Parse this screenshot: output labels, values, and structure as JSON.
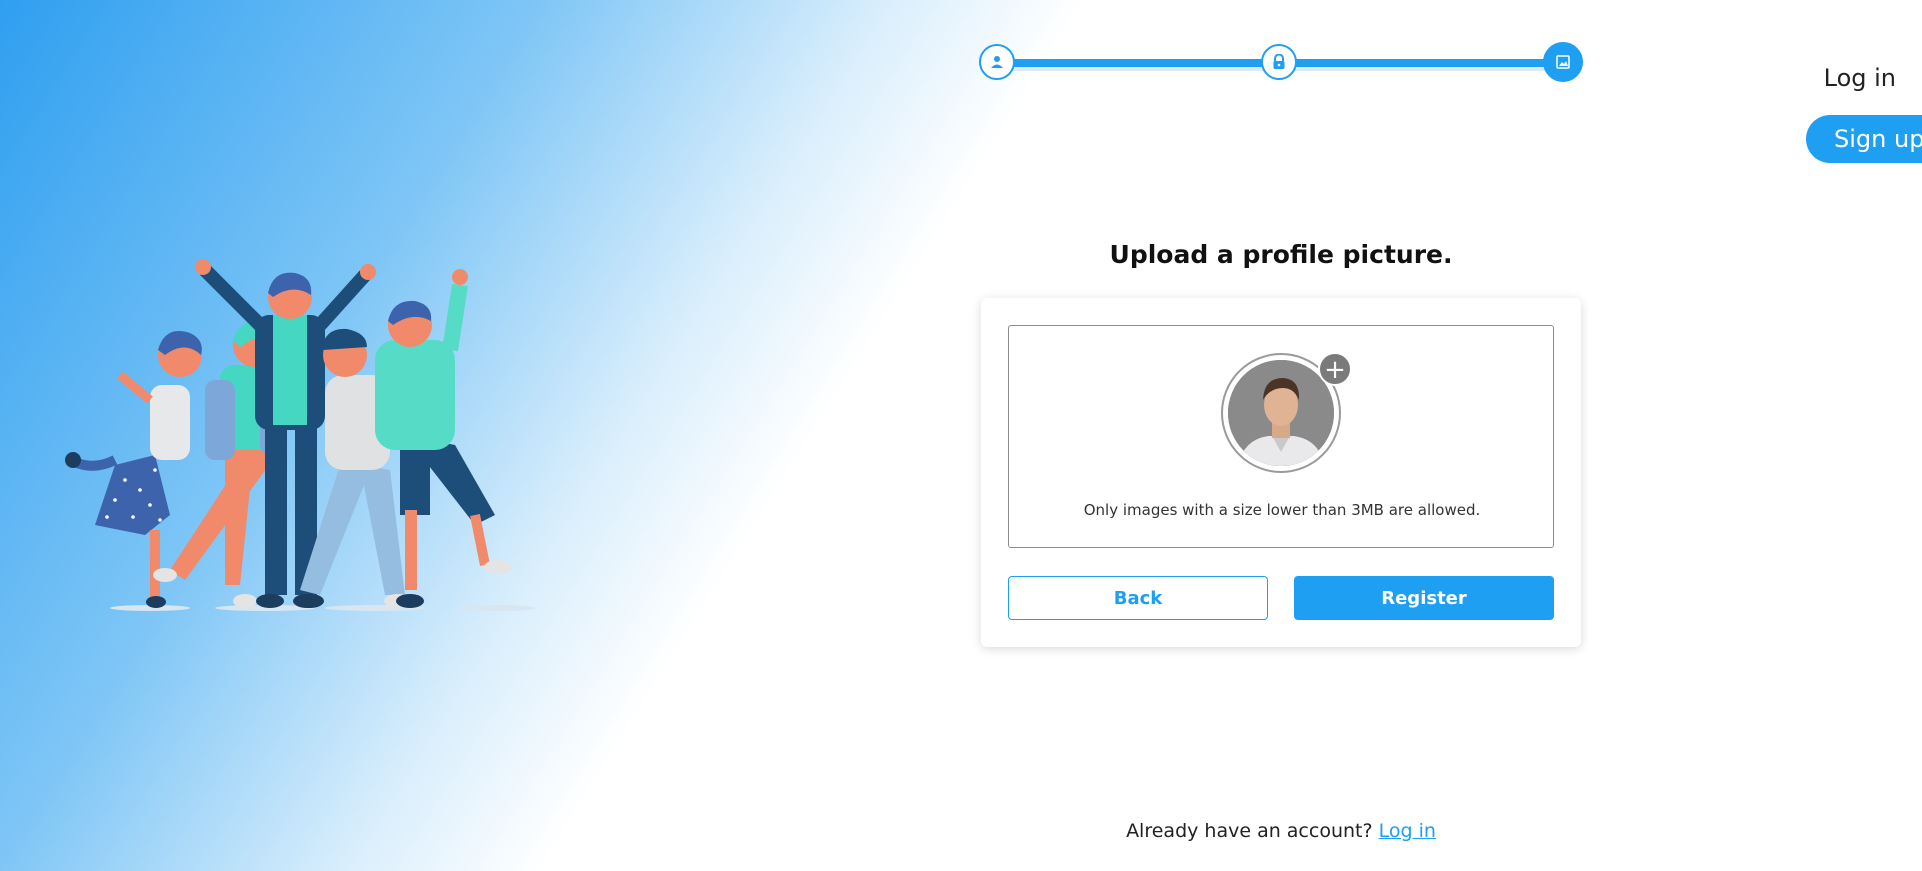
{
  "header": {
    "login_label": "Log in",
    "signup_label": "Sign up"
  },
  "stepper": {
    "steps": [
      {
        "icon": "user-icon",
        "state": "complete"
      },
      {
        "icon": "lock-icon",
        "state": "complete"
      },
      {
        "icon": "image-icon",
        "state": "active"
      }
    ]
  },
  "form": {
    "title": "Upload a profile picture.",
    "upload_hint": "Only images with a size lower than 3MB are allowed.",
    "add_symbol": "+",
    "back_label": "Back",
    "register_label": "Register"
  },
  "footer": {
    "prompt": "Already have an account?",
    "login_link": "Log in"
  },
  "colors": {
    "accent": "#1e9ff2",
    "gradient_start": "#2f9ff0"
  }
}
